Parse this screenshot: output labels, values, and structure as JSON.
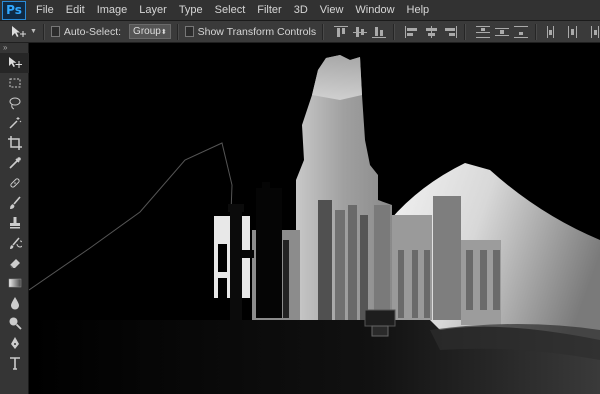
{
  "app": {
    "logo": "Ps"
  },
  "menu": [
    "File",
    "Edit",
    "Image",
    "Layer",
    "Type",
    "Select",
    "Filter",
    "3D",
    "View",
    "Window",
    "Help"
  ],
  "options": {
    "auto_select_label": "Auto-Select:",
    "group_value": "Group",
    "show_transform_label": "Show Transform Controls"
  },
  "tools": [
    "move-tool-icon",
    "marquee-tool-icon",
    "lasso-tool-icon",
    "magic-wand-icon",
    "crop-tool-icon",
    "eyedropper-icon",
    "healing-brush-icon",
    "brush-tool-icon",
    "clone-stamp-icon",
    "history-brush-icon",
    "eraser-icon",
    "gradient-icon",
    "blur-icon",
    "dodge-icon",
    "pen-tool-icon",
    "type-tool-icon"
  ],
  "colors": {
    "menubar": "#323232",
    "optionsbar": "#3a3a3a",
    "toolpanel": "#353535",
    "canvas": "#000000"
  }
}
